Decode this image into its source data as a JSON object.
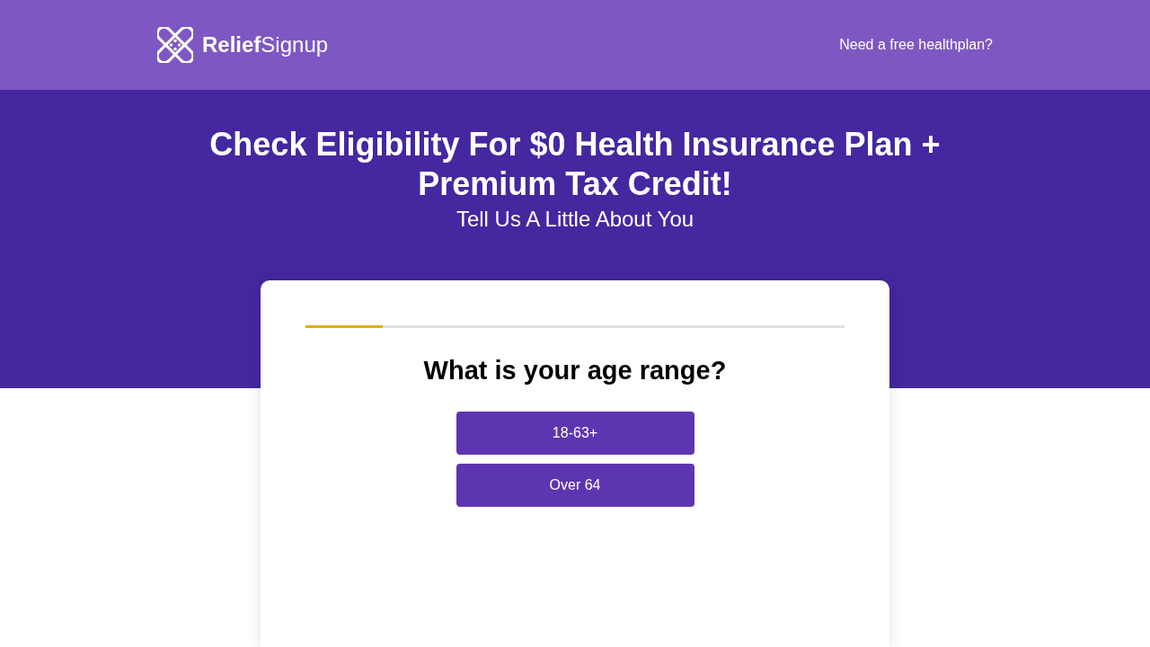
{
  "header": {
    "logo_text": "**Relief**Signup",
    "nav_link": "Need a free healthplan?"
  },
  "hero": {
    "title": "Check Eligibility For $0 Health Insurance Plan + Premium Tax Credit!",
    "subtitle": "Tell Us A Little About You"
  },
  "form_card": {
    "progress": {
      "level": 0.143
    },
    "question": "What is your age range?",
    "options": [
      {
        "label": "18-63+"
      },
      {
        "label": "Over 64"
      }
    ]
  }
}
